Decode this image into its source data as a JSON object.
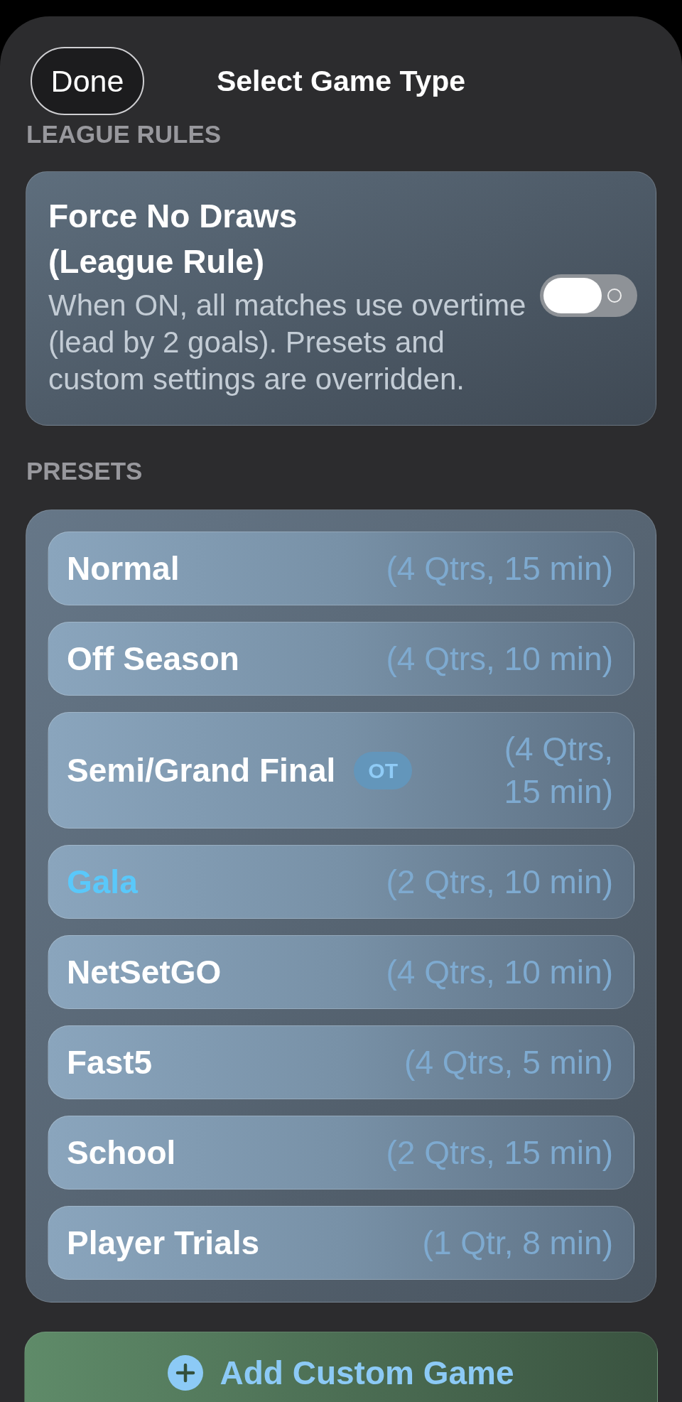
{
  "header": {
    "done_button": "Done",
    "title": "Select Game Type"
  },
  "league_rules": {
    "section_label": "LEAGUE RULES",
    "title": "Force No Draws (League Rule)",
    "description": "When ON, all matches use overtime (lead by 2 goals). Presets and custom settings are overridden.",
    "on": false
  },
  "presets": {
    "section_label": "PRESETS",
    "items": [
      {
        "name": "Normal",
        "detail": "(4 Qtrs, 15 min)",
        "selected": false
      },
      {
        "name": "Off Season",
        "detail": "(4 Qtrs, 10 min)",
        "selected": false
      },
      {
        "name": "Semi/Grand Final",
        "badge": "OT",
        "detail": "(4 Qtrs, 15 min)",
        "selected": false
      },
      {
        "name": "Gala",
        "detail": "(2 Qtrs, 10 min)",
        "selected": true
      },
      {
        "name": "NetSetGO",
        "detail": "(4 Qtrs, 10 min)",
        "selected": false
      },
      {
        "name": "Fast5",
        "detail": "(4 Qtrs, 5 min)",
        "selected": false
      },
      {
        "name": "School",
        "detail": "(2 Qtrs, 15 min)",
        "selected": false
      },
      {
        "name": "Player Trials",
        "detail": "(1 Qtr, 8 min)",
        "selected": false
      }
    ]
  },
  "add_button": {
    "label": "Add Custom Game"
  }
}
